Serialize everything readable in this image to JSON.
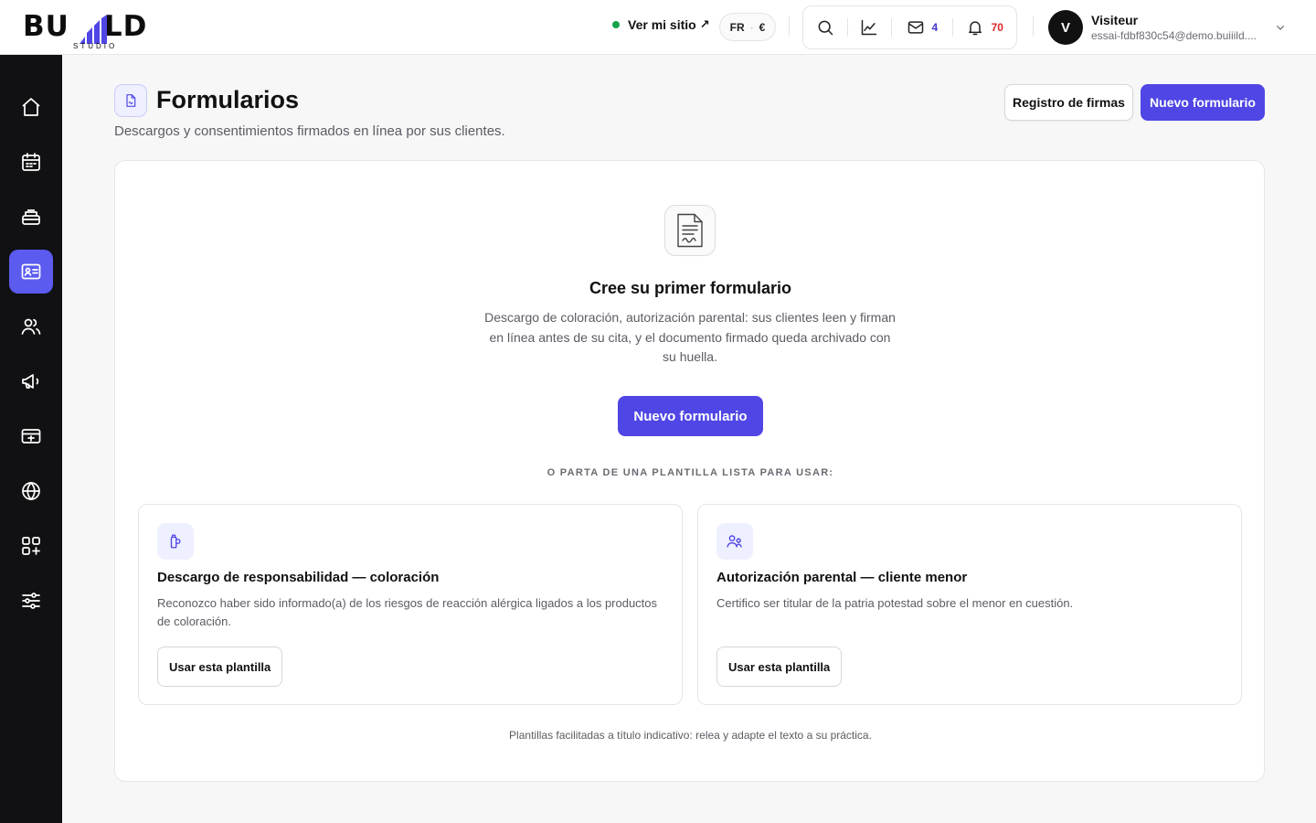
{
  "brand": {
    "logo_text": "BU  LD",
    "logo_sub": "STUDIO"
  },
  "header": {
    "site_link": "Ver mi sitio",
    "site_link_arrow": "↗",
    "locale_lang": "FR",
    "locale_sep": "·",
    "locale_currency": "€",
    "mail_count": "4",
    "notif_count": "70",
    "user": {
      "initial": "V",
      "name": "Visiteur",
      "email": "essai-fdbf830c54@demo.buiiild...."
    }
  },
  "sidebar": {
    "items": [
      {
        "icon": "home-icon"
      },
      {
        "icon": "calendar-icon"
      },
      {
        "icon": "register-icon"
      },
      {
        "icon": "id-card-icon",
        "active": true
      },
      {
        "icon": "users-icon"
      },
      {
        "icon": "megaphone-icon"
      },
      {
        "icon": "payment-icon"
      },
      {
        "icon": "globe-icon"
      },
      {
        "icon": "apps-icon"
      },
      {
        "icon": "sliders-icon"
      }
    ]
  },
  "page": {
    "title": "Formularios",
    "subtitle": "Descargos y consentimientos firmados en línea por sus clientes.",
    "btn_signatures": "Registro de firmas",
    "btn_new": "Nuevo formulario"
  },
  "empty": {
    "title": "Cree su primer formulario",
    "description": "Descargo de coloración, autorización parental: sus clientes leen y firman en línea antes de su cita, y el documento firmado queda archivado con su huella.",
    "button": "Nuevo formulario",
    "templates_label": "O PARTA DE UNA PLANTILLA LISTA PARA USAR:"
  },
  "templates": [
    {
      "icon": "dye-bottle-icon",
      "title": "Descargo de responsabilidad — coloración",
      "description": "Reconozco haber sido informado(a) de los riesgos de reacción alérgica ligados a los productos de coloración.",
      "button": "Usar esta plantilla"
    },
    {
      "icon": "parent-child-icon",
      "title": "Autorización parental — cliente menor",
      "description": "Certifico ser titular de la patria potestad sobre el menor en cuestión.",
      "button": "Usar esta plantilla"
    }
  ],
  "footnote": "Plantillas facilitadas a título indicativo: relea y adapte el texto a su práctica.",
  "colors": {
    "accent": "#4f46e5",
    "sidebar_bg": "#111113",
    "active_nav": "#5b5bf0",
    "online": "#16a34a",
    "notif": "#dc2626"
  }
}
